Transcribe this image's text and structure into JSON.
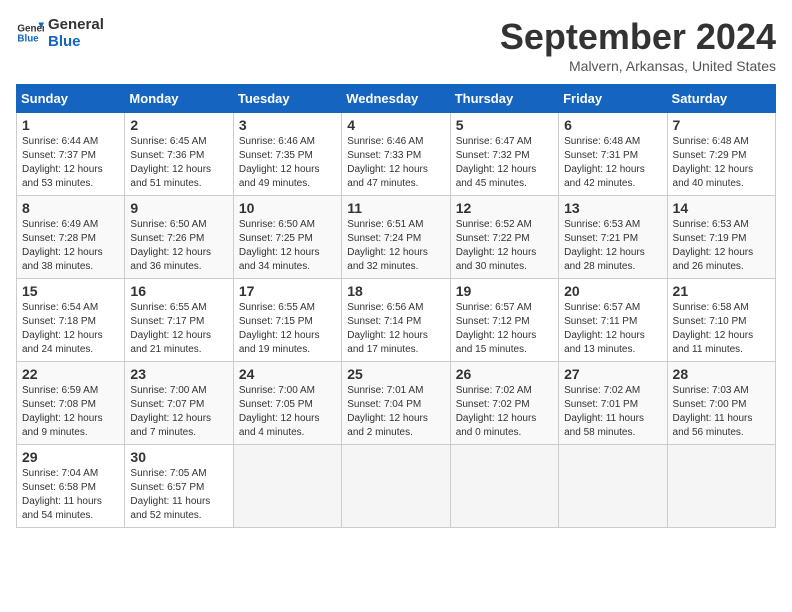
{
  "logo": {
    "line1": "General",
    "line2": "Blue"
  },
  "title": "September 2024",
  "location": "Malvern, Arkansas, United States",
  "weekdays": [
    "Sunday",
    "Monday",
    "Tuesday",
    "Wednesday",
    "Thursday",
    "Friday",
    "Saturday"
  ],
  "weeks": [
    [
      {
        "day": "1",
        "sunrise": "6:44 AM",
        "sunset": "7:37 PM",
        "daylight": "12 hours and 53 minutes."
      },
      {
        "day": "2",
        "sunrise": "6:45 AM",
        "sunset": "7:36 PM",
        "daylight": "12 hours and 51 minutes."
      },
      {
        "day": "3",
        "sunrise": "6:46 AM",
        "sunset": "7:35 PM",
        "daylight": "12 hours and 49 minutes."
      },
      {
        "day": "4",
        "sunrise": "6:46 AM",
        "sunset": "7:33 PM",
        "daylight": "12 hours and 47 minutes."
      },
      {
        "day": "5",
        "sunrise": "6:47 AM",
        "sunset": "7:32 PM",
        "daylight": "12 hours and 45 minutes."
      },
      {
        "day": "6",
        "sunrise": "6:48 AM",
        "sunset": "7:31 PM",
        "daylight": "12 hours and 42 minutes."
      },
      {
        "day": "7",
        "sunrise": "6:48 AM",
        "sunset": "7:29 PM",
        "daylight": "12 hours and 40 minutes."
      }
    ],
    [
      {
        "day": "8",
        "sunrise": "6:49 AM",
        "sunset": "7:28 PM",
        "daylight": "12 hours and 38 minutes."
      },
      {
        "day": "9",
        "sunrise": "6:50 AM",
        "sunset": "7:26 PM",
        "daylight": "12 hours and 36 minutes."
      },
      {
        "day": "10",
        "sunrise": "6:50 AM",
        "sunset": "7:25 PM",
        "daylight": "12 hours and 34 minutes."
      },
      {
        "day": "11",
        "sunrise": "6:51 AM",
        "sunset": "7:24 PM",
        "daylight": "12 hours and 32 minutes."
      },
      {
        "day": "12",
        "sunrise": "6:52 AM",
        "sunset": "7:22 PM",
        "daylight": "12 hours and 30 minutes."
      },
      {
        "day": "13",
        "sunrise": "6:53 AM",
        "sunset": "7:21 PM",
        "daylight": "12 hours and 28 minutes."
      },
      {
        "day": "14",
        "sunrise": "6:53 AM",
        "sunset": "7:19 PM",
        "daylight": "12 hours and 26 minutes."
      }
    ],
    [
      {
        "day": "15",
        "sunrise": "6:54 AM",
        "sunset": "7:18 PM",
        "daylight": "12 hours and 24 minutes."
      },
      {
        "day": "16",
        "sunrise": "6:55 AM",
        "sunset": "7:17 PM",
        "daylight": "12 hours and 21 minutes."
      },
      {
        "day": "17",
        "sunrise": "6:55 AM",
        "sunset": "7:15 PM",
        "daylight": "12 hours and 19 minutes."
      },
      {
        "day": "18",
        "sunrise": "6:56 AM",
        "sunset": "7:14 PM",
        "daylight": "12 hours and 17 minutes."
      },
      {
        "day": "19",
        "sunrise": "6:57 AM",
        "sunset": "7:12 PM",
        "daylight": "12 hours and 15 minutes."
      },
      {
        "day": "20",
        "sunrise": "6:57 AM",
        "sunset": "7:11 PM",
        "daylight": "12 hours and 13 minutes."
      },
      {
        "day": "21",
        "sunrise": "6:58 AM",
        "sunset": "7:10 PM",
        "daylight": "12 hours and 11 minutes."
      }
    ],
    [
      {
        "day": "22",
        "sunrise": "6:59 AM",
        "sunset": "7:08 PM",
        "daylight": "12 hours and 9 minutes."
      },
      {
        "day": "23",
        "sunrise": "7:00 AM",
        "sunset": "7:07 PM",
        "daylight": "12 hours and 7 minutes."
      },
      {
        "day": "24",
        "sunrise": "7:00 AM",
        "sunset": "7:05 PM",
        "daylight": "12 hours and 4 minutes."
      },
      {
        "day": "25",
        "sunrise": "7:01 AM",
        "sunset": "7:04 PM",
        "daylight": "12 hours and 2 minutes."
      },
      {
        "day": "26",
        "sunrise": "7:02 AM",
        "sunset": "7:02 PM",
        "daylight": "12 hours and 0 minutes."
      },
      {
        "day": "27",
        "sunrise": "7:02 AM",
        "sunset": "7:01 PM",
        "daylight": "11 hours and 58 minutes."
      },
      {
        "day": "28",
        "sunrise": "7:03 AM",
        "sunset": "7:00 PM",
        "daylight": "11 hours and 56 minutes."
      }
    ],
    [
      {
        "day": "29",
        "sunrise": "7:04 AM",
        "sunset": "6:58 PM",
        "daylight": "11 hours and 54 minutes."
      },
      {
        "day": "30",
        "sunrise": "7:05 AM",
        "sunset": "6:57 PM",
        "daylight": "11 hours and 52 minutes."
      },
      {
        "day": "",
        "sunrise": "",
        "sunset": "",
        "daylight": ""
      },
      {
        "day": "",
        "sunrise": "",
        "sunset": "",
        "daylight": ""
      },
      {
        "day": "",
        "sunrise": "",
        "sunset": "",
        "daylight": ""
      },
      {
        "day": "",
        "sunrise": "",
        "sunset": "",
        "daylight": ""
      },
      {
        "day": "",
        "sunrise": "",
        "sunset": "",
        "daylight": ""
      }
    ]
  ]
}
